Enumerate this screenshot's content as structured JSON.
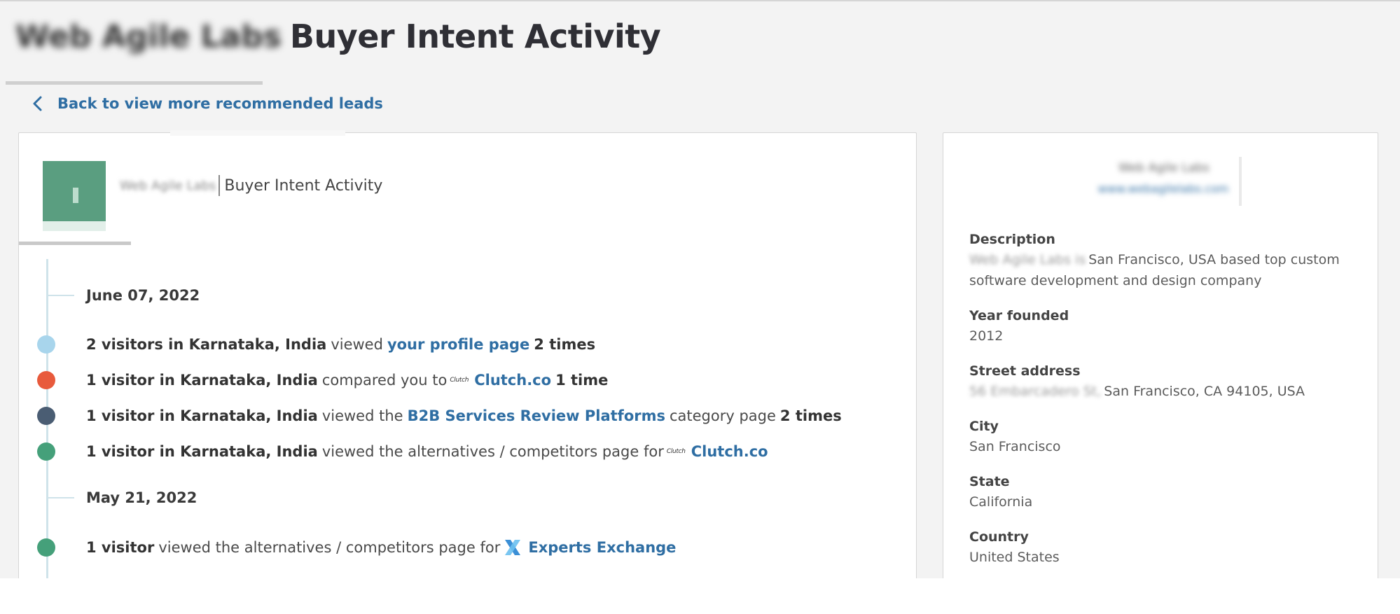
{
  "page": {
    "company_name": "Web Agile Labs",
    "title": "Buyer Intent Activity",
    "back_link": "Back to view more recommended leads"
  },
  "card": {
    "company_name": "Web Agile Labs",
    "title": "Buyer Intent Activity"
  },
  "timeline": {
    "groups": [
      {
        "date": "June 07, 2022",
        "events": [
          {
            "color": "#a8d5ec",
            "actor": "2 visitors in Karnataka, India",
            "verb": "viewed",
            "link": "your profile page",
            "count": "2 times"
          },
          {
            "color": "#e85a3c",
            "actor": "1 visitor in Karnataka, India",
            "verb": "compared you to",
            "logo": "Clutch",
            "link": "Clutch.co",
            "count": "1 time"
          },
          {
            "color": "#4a5d73",
            "actor": "1 visitor in Karnataka, India",
            "verb": "viewed the",
            "link": "B2B Services Review Platforms",
            "after": "category page",
            "count": "2 times"
          },
          {
            "color": "#45a07a",
            "actor": "1 visitor in Karnataka, India",
            "verb": "viewed the alternatives / competitors page for",
            "logo": "Clutch",
            "link": "Clutch.co"
          }
        ]
      },
      {
        "date": "May 21, 2022",
        "events": [
          {
            "color": "#45a07a",
            "actor": "1 visitor",
            "verb": "viewed the alternatives / competitors page for",
            "logo_icon": "experts-exchange-icon",
            "link": "Experts Exchange"
          }
        ]
      }
    ]
  },
  "sidebar": {
    "company_name": "Web Agile Labs",
    "email": "www.webagilelabs.com",
    "fields": [
      {
        "label": "Description",
        "value_blur": "Web Agile Labs is",
        "value": "San Francisco, USA based top custom software development and design company"
      },
      {
        "label": "Year founded",
        "value": "2012"
      },
      {
        "label": "Street address",
        "value_blur": "56 Embarcadero St,",
        "value": "San Francisco, CA 94105, USA"
      },
      {
        "label": "City",
        "value": "San Francisco"
      },
      {
        "label": "State",
        "value": "California"
      },
      {
        "label": "Country",
        "value": "United States"
      }
    ]
  },
  "icons": {
    "back": "chevron-left-icon",
    "experts_exchange": "experts-exchange-icon"
  },
  "colors": {
    "link": "#2f6ea3",
    "timeline": "#cfe3ea",
    "logo": "#5a9e80"
  }
}
